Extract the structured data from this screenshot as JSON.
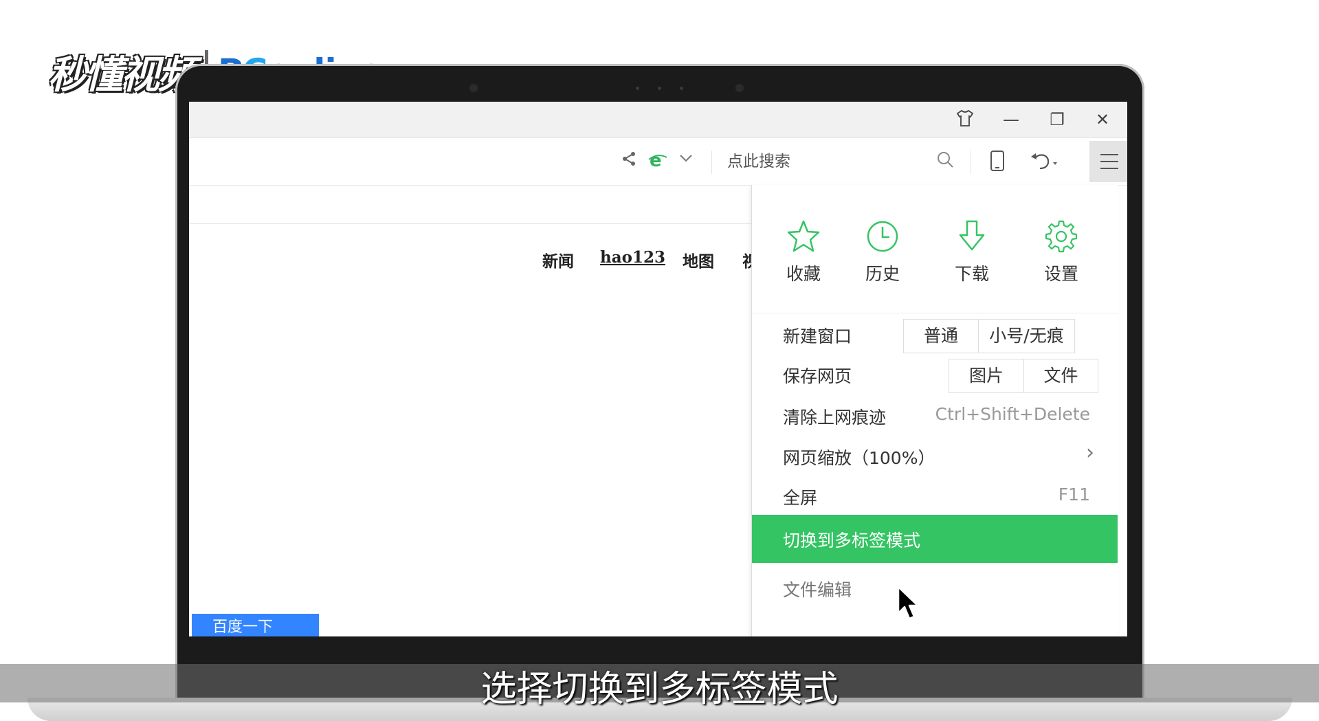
{
  "watermark": {
    "brand1": "秒懂视频",
    "brand2_p": "P",
    "brand2_c": "C",
    "brand2_rest": "online"
  },
  "window": {
    "skin_icon": "tshirt-icon",
    "minimize_glyph": "—",
    "restore_glyph": "❐",
    "close_glyph": "✕"
  },
  "toolbar": {
    "share_icon": "share-icon",
    "ie_icon": "ie-mode-icon",
    "search_placeholder": "点此搜索",
    "search_icon": "search-icon",
    "phone_icon": "phone-icon",
    "undo_icon": "undo-icon",
    "menu_icon": "hamburger-menu-icon"
  },
  "page": {
    "nav": [
      "新闻",
      "hao123",
      "地图",
      "视"
    ],
    "baidu_button": "百度一下"
  },
  "menu": {
    "quick": [
      {
        "label": "收藏",
        "icon": "star-icon"
      },
      {
        "label": "历史",
        "icon": "clock-icon"
      },
      {
        "label": "下载",
        "icon": "download-icon"
      },
      {
        "label": "设置",
        "icon": "gear-icon"
      }
    ],
    "new_window": {
      "label": "新建窗口",
      "opt1": "普通",
      "opt2": "小号/无痕"
    },
    "save_page": {
      "label": "保存网页",
      "opt1": "图片",
      "opt2": "文件"
    },
    "clear": {
      "label": "清除上网痕迹",
      "shortcut": "Ctrl+Shift+Delete"
    },
    "zoom": {
      "label": "网页缩放（100%）",
      "arrow": "›"
    },
    "fullscreen": {
      "label": "全屏",
      "shortcut": "F11"
    },
    "switch_tabs": {
      "label": "切换到多标签模式"
    },
    "partial": {
      "label": "文件编辑"
    }
  },
  "colors": {
    "accent_green": "#34c463",
    "baidu_blue": "#3385ff"
  },
  "subtitle": "选择切换到多标签模式"
}
